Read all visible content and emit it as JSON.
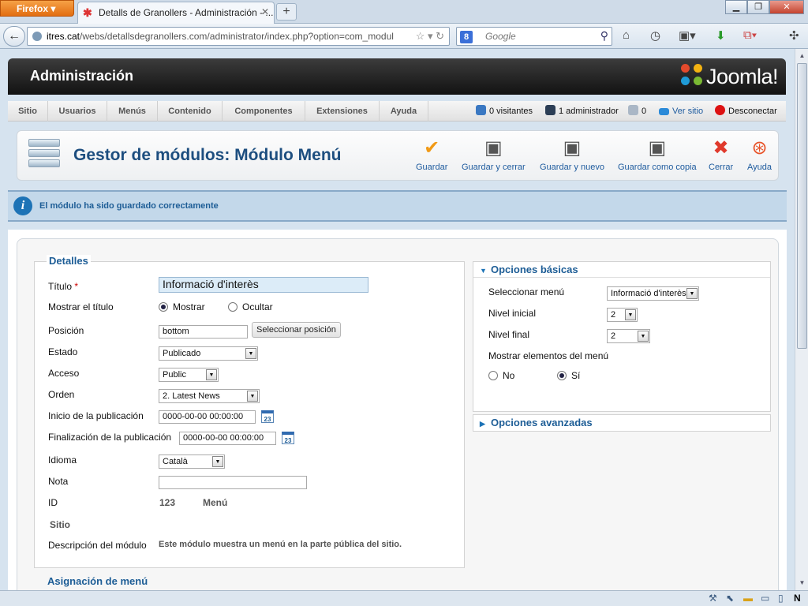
{
  "browser": {
    "app_button": "Firefox",
    "tab_title": "Detalls de Granollers - Administración - ...",
    "url_domain": "itres.cat",
    "url_path": "/webs/detallsdegranollers.com/administrator/index.php?option=com_modul",
    "search_placeholder": "Google"
  },
  "header": {
    "title": "Administración",
    "logo_text": "Joomla!"
  },
  "menu": {
    "items": [
      "Sitio",
      "Usuarios",
      "Menús",
      "Contenido",
      "Componentes",
      "Extensiones",
      "Ayuda"
    ],
    "status": {
      "visitors": "0 visitantes",
      "admins": "1 administrador",
      "messages": "0",
      "view_site": "Ver sitio",
      "logout": "Desconectar"
    }
  },
  "toolbar": {
    "page_title": "Gestor de módulos: Módulo Menú",
    "buttons": [
      "Guardar",
      "Guardar y cerrar",
      "Guardar y nuevo",
      "Guardar como copia",
      "Cerrar",
      "Ayuda"
    ]
  },
  "message": "El módulo ha sido guardado correctamente",
  "details": {
    "legend": "Detalles",
    "title_label": "Título",
    "required_mark": "*",
    "title_value": "Informació d'interès",
    "show_title_label": "Mostrar el título",
    "show_option": "Mostrar",
    "hide_option": "Ocultar",
    "position_label": "Posición",
    "position_value": "bottom",
    "select_position_button": "Seleccionar posición",
    "state_label": "Estado",
    "state_value": "Publicado",
    "access_label": "Acceso",
    "access_value": "Public",
    "order_label": "Orden",
    "order_value": "2. Latest News",
    "publish_up_label": "Inicio de la publicación",
    "publish_up_value": "0000-00-00 00:00:00",
    "publish_down_label": "Finalización de la publicación",
    "publish_down_value": "0000-00-00 00:00:00",
    "calendar_day": "23",
    "language_label": "Idioma",
    "language_value": "Català",
    "note_label": "Nota",
    "note_value": "",
    "id_label": "ID",
    "id_value": "123",
    "module_type": "Menú",
    "site_label": "Sitio",
    "description_label": "Descripción del módulo",
    "description_value": "Este módulo muestra un menú en la parte pública del sitio.",
    "next_section_partial": "Asignación de menú"
  },
  "basic_options": {
    "header": "Opciones básicas",
    "select_menu_label": "Seleccionar menú",
    "select_menu_value": "Informació d'interès",
    "start_level_label": "Nivel inicial",
    "start_level_value": "2",
    "end_level_label": "Nivel final",
    "end_level_value": "2",
    "show_subitems_label": "Mostrar elementos del menú",
    "no_option": "No",
    "yes_option": "Sí"
  },
  "advanced_options": {
    "header": "Opciones avanzadas"
  },
  "colors": {
    "link_blue": "#1e5b9e",
    "title_blue": "#1d4e7f",
    "header_black": "#121212",
    "message_bg": "#c3d8ea"
  }
}
